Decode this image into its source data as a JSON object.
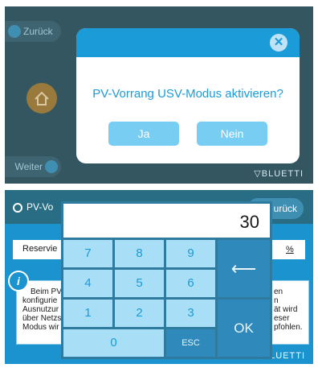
{
  "screen1": {
    "back_label": "Zurück",
    "next_label": "Weiter",
    "brand": "BLUETTI",
    "dialog": {
      "close_symbol": "✕",
      "message": "PV-Vorrang USV-Modus aktivieren?",
      "yes_label": "Ja",
      "no_label": "Nein"
    }
  },
  "screen2": {
    "title": "PV-Vo",
    "back_label": "urück",
    "reserve_label": "Reservie",
    "percent_label": "%",
    "info_icon": "i",
    "info_left": [
      "Beim PV",
      "konfigurie",
      "Ausnutzur",
      "über Netzs",
      "Modus wir"
    ],
    "info_right": [
      "en",
      "n",
      "ät wird",
      "eser",
      "pfohlen."
    ],
    "brand": "BLUETTI",
    "keypad": {
      "value": "30",
      "keys": {
        "k7": "7",
        "k8": "8",
        "k9": "9",
        "k4": "4",
        "k5": "5",
        "k6": "6",
        "k1": "1",
        "k2": "2",
        "k3": "3",
        "k0": "0",
        "esc": "ESC",
        "backspace": "⟵",
        "ok": "OK"
      }
    }
  },
  "colors": {
    "accent": "#1b9bd7",
    "button": "#78cdf2",
    "key": "#a8def6",
    "key_dark": "#2f89bb",
    "overlay": "#345660"
  }
}
